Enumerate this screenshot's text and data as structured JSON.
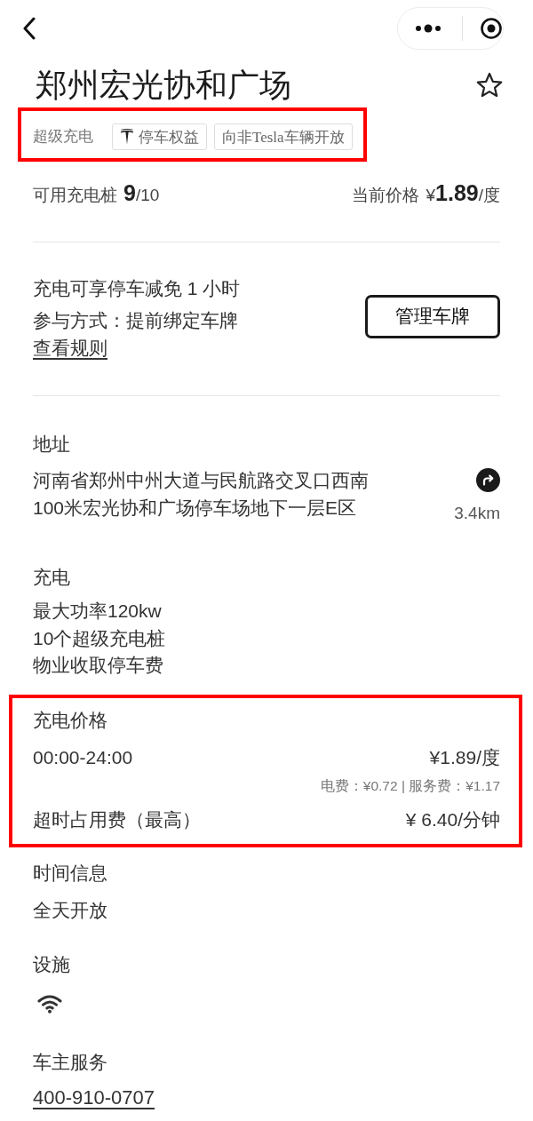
{
  "title": "郑州宏光协和广场",
  "favorited": false,
  "tags": {
    "highlighted": true,
    "items": [
      {
        "kind": "text",
        "label": "超级充电"
      },
      {
        "kind": "logo-chip",
        "label": "停车权益"
      },
      {
        "kind": "chip",
        "label": "向非Tesla车辆开放"
      }
    ]
  },
  "stats": {
    "available_label": "可用充电桩",
    "available": "**9**/10",
    "price_label": "当前价格",
    "price": "¥**1.89**/度"
  },
  "parking": {
    "lines": [
      "充电可享停车减免 1 小时",
      "参与方式：提前绑定车牌"
    ],
    "link": "查看规则",
    "button": "管理车牌"
  },
  "address": {
    "title": "地址",
    "text": "河南省郑州中州大道与民航路交叉口西南100米宏光协和广场停车场地下一层E区",
    "distance": "3.4km"
  },
  "charging": {
    "title": "充电",
    "lines": [
      "最大功率120kw",
      "10个超级充电桩",
      "物业收取停车费"
    ]
  },
  "pricing": {
    "highlighted": true,
    "title": "充电价格",
    "rows": [
      {
        "kind": "main",
        "label": "00:00-24:00",
        "value": "¥1.89/度"
      },
      {
        "kind": "detail",
        "value": "电费：¥0.72 | 服务费：¥1.17"
      },
      {
        "kind": "main",
        "label": "超时占用费（最高）",
        "value": "¥ 6.40/分钟"
      }
    ]
  },
  "hours": {
    "title": "时间信息",
    "text": "全天开放"
  },
  "facilities": {
    "title": "设施",
    "items": [
      {
        "kind": "wifi"
      }
    ]
  },
  "service": {
    "title": "车主服务",
    "phone": "400-910-0707"
  }
}
